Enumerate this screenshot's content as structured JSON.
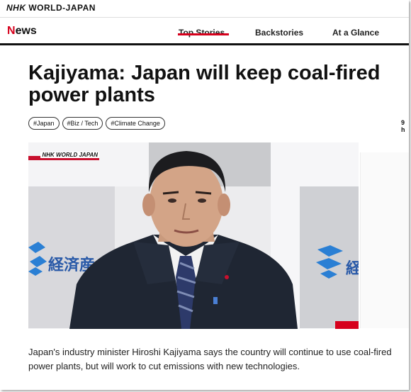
{
  "brand": {
    "nhk": "NHK",
    "world": "WORLD-JAPAN"
  },
  "nav": {
    "section": "News",
    "items": [
      {
        "label": "Top Stories",
        "active": true
      },
      {
        "label": "Backstories",
        "active": false
      },
      {
        "label": "At a Glance",
        "active": false
      }
    ]
  },
  "article": {
    "headline": "Kajiyama: Japan will keep coal-fired power plants",
    "tags": [
      "#Japan",
      "#Biz / Tech",
      "#Climate Change"
    ],
    "time": "9 h",
    "caption": "Japan's industry minister Hiroshi Kajiyama says the country will continue to use coal-fired power plants, but will work to cut emissions with new technologies."
  },
  "video": {
    "badge": "NHK WORLD JAPAN",
    "backdrop_text_left": "経済産",
    "backdrop_text_right": "経"
  },
  "colors": {
    "accent": "#d6001c",
    "backdrop_logo": "#2a7fd4"
  }
}
